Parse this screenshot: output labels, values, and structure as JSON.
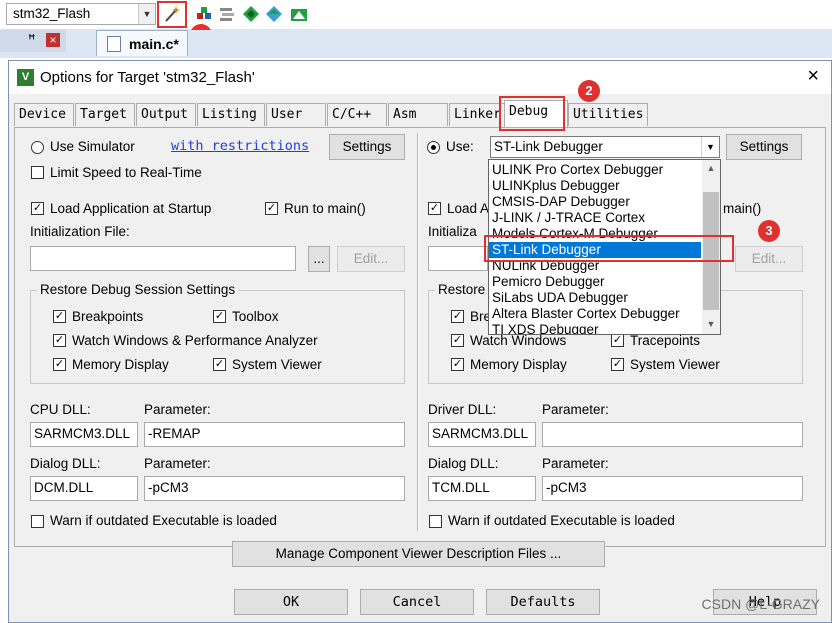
{
  "toolbar": {
    "target_name": "stm32_Flash",
    "icons": [
      "dropdown-arrow-icon",
      "magic-wand-icon",
      "manage-project-icon",
      "multiproject-icon",
      "pack-installer-icon",
      "select-pack-icon",
      "manage-runtime-icon"
    ],
    "annotation_1": "1"
  },
  "editor": {
    "pin_label": "ꟸ",
    "close_label": "×",
    "file_tab": "main.c*"
  },
  "dialog": {
    "title": "Options for Target 'stm32_Flash'",
    "close": "×",
    "tabs": [
      "Device",
      "Target",
      "Output",
      "Listing",
      "User",
      "C/C++",
      "Asm",
      "Linker",
      "Debug",
      "Utilities"
    ],
    "active_tab": "Debug",
    "annotation_2": "2",
    "annotation_3": "3"
  },
  "left": {
    "use_simulator": "Use Simulator",
    "with_restrictions": "with restrictions",
    "settings": "Settings",
    "limit_speed": "Limit Speed to Real-Time",
    "load_app": "Load Application at Startup",
    "run_to_main": "Run to main()",
    "init_file": "Initialization File:",
    "browse": "...",
    "edit": "Edit...",
    "restore_group": "Restore Debug Session Settings",
    "breakpoints": "Breakpoints",
    "toolbox": "Toolbox",
    "watch": "Watch Windows & Performance Analyzer",
    "memory": "Memory Display",
    "system_viewer": "System Viewer",
    "cpu_dll_label": "CPU DLL:",
    "cpu_param_label": "Parameter:",
    "cpu_dll": "SARMCM3.DLL",
    "cpu_param": "-REMAP",
    "dialog_dll_label": "Dialog DLL:",
    "dialog_param_label": "Parameter:",
    "dialog_dll": "DCM.DLL",
    "dialog_param": "-pCM3",
    "warn": "Warn if outdated Executable is loaded"
  },
  "right": {
    "use": "Use:",
    "debugger": "ST-Link Debugger",
    "settings": "Settings",
    "load_app_partial": "Load A",
    "run_to_main_partial": "main()",
    "init_file_partial": "Initializa",
    "edit": "Edit...",
    "restore_partial": "Restore",
    "breakpoints_partial": "Bre",
    "watch": "Watch Windows",
    "tracepoints": "Tracepoints",
    "memory": "Memory Display",
    "system_viewer": "System Viewer",
    "driver_dll_label": "Driver DLL:",
    "driver_param_label": "Parameter:",
    "driver_dll": "SARMCM3.DLL",
    "driver_param": "",
    "dialog_dll_label": "Dialog DLL:",
    "dialog_param_label": "Parameter:",
    "dialog_dll": "TCM.DLL",
    "dialog_param": "-pCM3",
    "warn": "Warn if outdated Executable is loaded",
    "dropdown_items": [
      "ULINK Pro Cortex Debugger",
      "ULINKplus Debugger",
      "CMSIS-DAP Debugger",
      "J-LINK / J-TRACE Cortex",
      "Models Cortex-M Debugger",
      "ST-Link Debugger",
      "NULink Debugger",
      "Pemicro Debugger",
      "SiLabs UDA Debugger",
      "Altera Blaster Cortex Debugger",
      "TI XDS Debugger"
    ],
    "selected_item": "ST-Link Debugger"
  },
  "bottom": {
    "manage_component": "Manage Component Viewer Description Files ...",
    "ok": "OK",
    "cancel": "Cancel",
    "defaults": "Defaults",
    "help": "Help"
  },
  "watermark": "CSDN @L-GRAZY",
  "colors": {
    "callout": "#e03030",
    "selection": "#0078d7",
    "link": "#2040d8"
  }
}
